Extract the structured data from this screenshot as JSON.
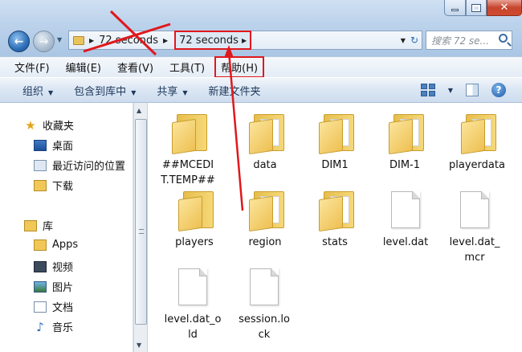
{
  "address": {
    "crumbs": [
      "72 seconds",
      "72 seconds"
    ],
    "search_placeholder": "搜索 72 se..."
  },
  "menu": [
    "文件(F)",
    "编辑(E)",
    "查看(V)",
    "工具(T)",
    "帮助(H)"
  ],
  "commands": {
    "organize": "组织",
    "include": "包含到库中",
    "share": "共享",
    "new_folder": "新建文件夹"
  },
  "nav": {
    "favorites": "收藏夹",
    "desktop": "桌面",
    "recent": "最近访问的位置",
    "downloads": "下载",
    "libraries": "库",
    "apps": "Apps",
    "videos": "视频",
    "pictures": "图片",
    "documents": "文档",
    "music": "音乐"
  },
  "files": [
    {
      "name": "##MCEDIT.TEMP##",
      "line1": "##MCEDI",
      "line2": "T.TEMP##",
      "type": "folder"
    },
    {
      "name": "data",
      "line1": "data",
      "line2": "",
      "type": "folder"
    },
    {
      "name": "DIM1",
      "line1": "DIM1",
      "line2": "",
      "type": "folder"
    },
    {
      "name": "DIM-1",
      "line1": "DIM-1",
      "line2": "",
      "type": "folder"
    },
    {
      "name": "playerdata",
      "line1": "playerdata",
      "line2": "",
      "type": "folder"
    },
    {
      "name": "players",
      "line1": "players",
      "line2": "",
      "type": "folder"
    },
    {
      "name": "region",
      "line1": "region",
      "line2": "",
      "type": "folder"
    },
    {
      "name": "stats",
      "line1": "stats",
      "line2": "",
      "type": "folder"
    },
    {
      "name": "level.dat",
      "line1": "level.dat",
      "line2": "",
      "type": "file"
    },
    {
      "name": "level.dat_mcr",
      "line1": "level.dat_",
      "line2": "mcr",
      "type": "file"
    },
    {
      "name": "level.dat_old",
      "line1": "level.dat_o",
      "line2": "ld",
      "type": "file"
    },
    {
      "name": "session.lock",
      "line1": "session.lo",
      "line2": "ck",
      "type": "file"
    }
  ],
  "colors": {
    "annotation_red": "#e0181c",
    "window_frame": "#bcd3ea"
  },
  "icons": {
    "back": "back-arrow-icon",
    "forward": "forward-arrow-icon",
    "refresh": "refresh-icon",
    "search": "search-icon",
    "help": "help-icon"
  }
}
